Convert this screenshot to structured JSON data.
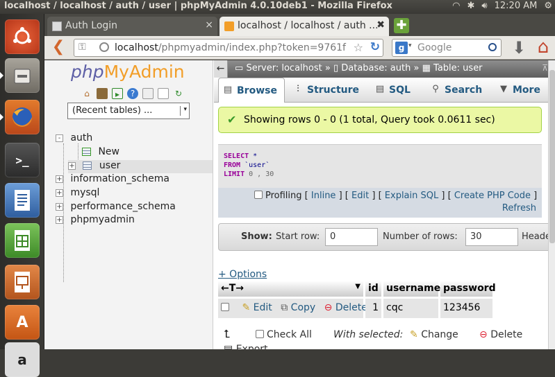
{
  "topbar": {
    "window_title": "localhost / localhost / auth / user | phpMyAdmin 4.0.10deb1 - Mozilla Firefox",
    "clock": "12:20 AM"
  },
  "browser": {
    "tabs": [
      {
        "label": "Auth Login",
        "close": "×"
      },
      {
        "label": "localhost / localhost / auth ...",
        "close": "✖"
      }
    ],
    "new_tab": "✚",
    "url_host": "localhost",
    "url_path": "/phpmyadmin/index.php?token=9761f",
    "search_placeholder": "Google"
  },
  "pma_nav": {
    "logo_php": "php",
    "logo_my": "My",
    "logo_admin": "Admin",
    "recent_tables": "(Recent tables) ...",
    "tree": [
      {
        "label": "auth",
        "expander": "-"
      },
      {
        "label": "New"
      },
      {
        "label": "user",
        "expander": "+"
      },
      {
        "label": "information_schema",
        "expander": "+"
      },
      {
        "label": "mysql",
        "expander": "+"
      },
      {
        "label": "performance_schema",
        "expander": "+"
      },
      {
        "label": "phpmyadmin",
        "expander": "+"
      }
    ]
  },
  "breadcrumb": {
    "server": "Server: localhost",
    "sep1": "»",
    "database": "Database: auth",
    "sep2": "»",
    "table": "Table: user"
  },
  "tabs": [
    {
      "label": "Browse"
    },
    {
      "label": "Structure"
    },
    {
      "label": "SQL"
    },
    {
      "label": "Search"
    },
    {
      "label": "More"
    }
  ],
  "message": {
    "text": "Showing rows 0 - 0 (1 total, Query took 0.0611 sec)"
  },
  "sql": {
    "select": "SELECT",
    "star": " *",
    "from": "FROM",
    "table": " `user`",
    "limit": "LIMIT",
    "limit_vals": " 0 , 30"
  },
  "sql_links": {
    "profiling": "Profiling",
    "inline": "Inline",
    "edit": "Edit",
    "explain": "Explain SQL",
    "create_php": "Create PHP Code",
    "refresh": "Refresh",
    "lb": "[",
    "rb": "]"
  },
  "show_bar": {
    "show": "Show",
    "colon": ":",
    "start_row_label": "Start row:",
    "start_row_value": "0",
    "rows_label": "Number of rows:",
    "rows_value": "30",
    "headers_label": "Heade"
  },
  "options_link": "+ Options",
  "results": {
    "sort_arrows": "←T→",
    "columns": [
      "id",
      "username",
      "password"
    ],
    "row": {
      "edit": "Edit",
      "copy": "Copy",
      "delete": "Delete",
      "id": "1",
      "username": "cqc",
      "password": "123456"
    }
  },
  "bulk": {
    "check_all": "Check All",
    "with_selected": "With selected:",
    "change": "Change",
    "delete": "Delete"
  },
  "export": "Export"
}
